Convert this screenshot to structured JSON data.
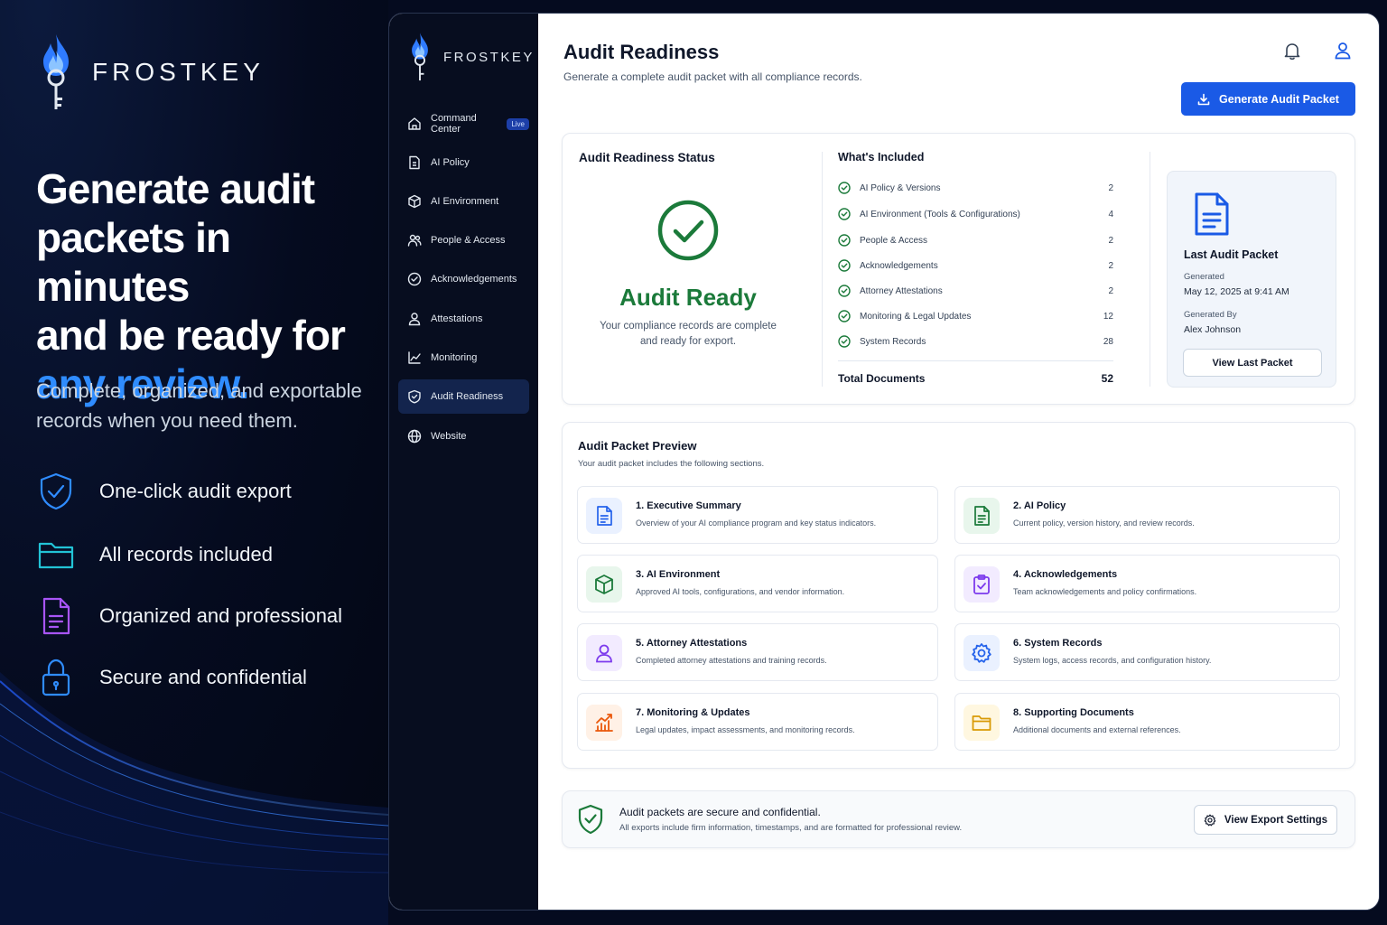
{
  "brand": {
    "name": "FROSTKEY"
  },
  "hero": {
    "title_line1": "Generate audit",
    "title_line2": "packets in minutes",
    "title_line3": "and be ready for",
    "title_accent": "any review.",
    "subtitle": "Complete, organized, and exportable records when you need them.",
    "features": [
      {
        "label": "One-click audit export",
        "icon": "shield-check-icon",
        "color": "#2f8cff"
      },
      {
        "label": "All records included",
        "icon": "folder-icon",
        "color": "#22c3d6"
      },
      {
        "label": "Organized and professional",
        "icon": "document-icon",
        "color": "#a855f7"
      },
      {
        "label": "Secure and confidential",
        "icon": "lock-icon",
        "color": "#2f8cff"
      }
    ]
  },
  "sidebar": {
    "items": [
      {
        "label": "Command Center",
        "badge": "Live",
        "icon": "home-icon"
      },
      {
        "label": "AI Policy",
        "icon": "policy-doc-icon"
      },
      {
        "label": "AI Environment",
        "icon": "cube-icon"
      },
      {
        "label": "People & Access",
        "icon": "users-icon"
      },
      {
        "label": "Acknowledgements",
        "icon": "check-circle-icon"
      },
      {
        "label": "Attestations",
        "icon": "user-icon"
      },
      {
        "label": "Monitoring",
        "icon": "chart-icon"
      },
      {
        "label": "Audit Readiness",
        "icon": "shield-icon",
        "active": true
      },
      {
        "label": "Website",
        "icon": "globe-icon"
      }
    ]
  },
  "header": {
    "title": "Audit Readiness",
    "subtitle": "Generate a complete audit packet with all compliance records.",
    "generate_button": "Generate Audit Packet"
  },
  "status": {
    "title": "Audit Readiness Status",
    "state": "Audit Ready",
    "description": "Your compliance records are complete and ready for export.",
    "included_title": "What's Included",
    "included": [
      {
        "label": "AI Policy & Versions",
        "count": "2"
      },
      {
        "label": "AI Environment (Tools & Configurations)",
        "count": "4"
      },
      {
        "label": "People & Access",
        "count": "2"
      },
      {
        "label": "Acknowledgements",
        "count": "2"
      },
      {
        "label": "Attorney Attestations",
        "count": "2"
      },
      {
        "label": "Monitoring & Legal Updates",
        "count": "12"
      },
      {
        "label": "System Records",
        "count": "28"
      }
    ],
    "total_label": "Total Documents",
    "total_value": "52",
    "last_packet": {
      "title": "Last Audit Packet",
      "generated_label": "Generated",
      "generated_value": "May 12, 2025 at 9:41 AM",
      "by_label": "Generated By",
      "by_value": "Alex Johnson",
      "button": "View Last Packet"
    }
  },
  "preview": {
    "title": "Audit Packet Preview",
    "subtitle": "Your audit packet includes the following sections.",
    "sections": [
      {
        "title": "1. Executive Summary",
        "desc": "Overview of your AI compliance program and key status indicators.",
        "icon": "document-icon",
        "color": "#2563eb",
        "bg": "#eaf1ff"
      },
      {
        "title": "2. AI Policy",
        "desc": "Current policy, version history, and review records.",
        "icon": "policy-doc-icon",
        "color": "#1b7a3a",
        "bg": "#e8f6ec"
      },
      {
        "title": "3. AI Environment",
        "desc": "Approved AI tools, configurations, and vendor information.",
        "icon": "cube-icon",
        "color": "#1b7a3a",
        "bg": "#e8f6ec"
      },
      {
        "title": "4. Acknowledgements",
        "desc": "Team acknowledgements and policy confirmations.",
        "icon": "clipboard-check-icon",
        "color": "#7c3aed",
        "bg": "#f2ebff"
      },
      {
        "title": "5. Attorney Attestations",
        "desc": "Completed attorney attestations and training records.",
        "icon": "user-icon",
        "color": "#7c3aed",
        "bg": "#f2ebff"
      },
      {
        "title": "6. System Records",
        "desc": "System logs, access records, and configuration history.",
        "icon": "gear-icon",
        "color": "#2563eb",
        "bg": "#eaf1ff"
      },
      {
        "title": "7. Monitoring & Updates",
        "desc": "Legal updates, impact assessments, and monitoring records.",
        "icon": "trend-chart-icon",
        "color": "#ea580c",
        "bg": "#fff1e6"
      },
      {
        "title": "8. Supporting Documents",
        "desc": "Additional documents and external references.",
        "icon": "folder-icon",
        "color": "#d99a06",
        "bg": "#fff7e0"
      }
    ]
  },
  "secure": {
    "title": "Audit packets are secure and confidential.",
    "desc": "All exports include firm information, timestamps, and are formatted for professional review.",
    "button": "View Export Settings"
  },
  "colors": {
    "accent": "#1a5ae6",
    "success": "#1b7a3a",
    "sidebar_bg": "#070d1f"
  }
}
